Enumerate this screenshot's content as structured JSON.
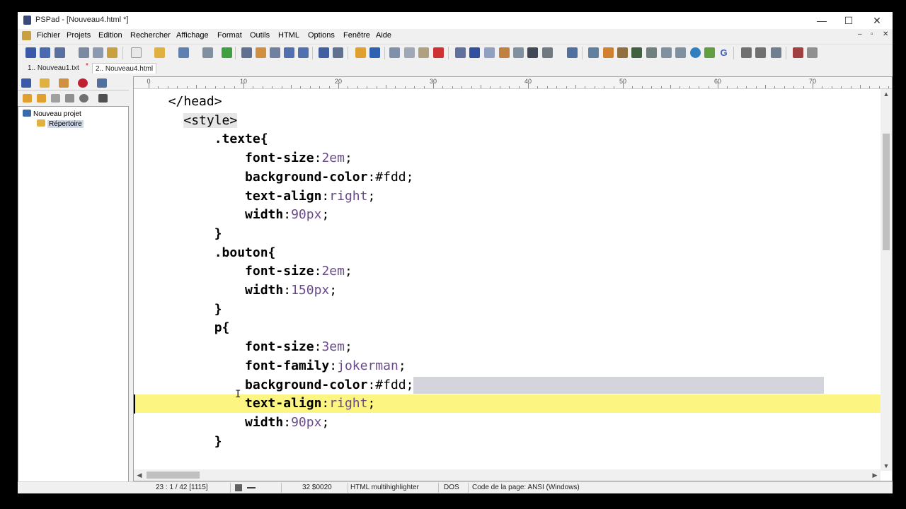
{
  "window": {
    "title": "PSPad - [Nouveau4.html *]",
    "minimize": "—",
    "maximize": "☐",
    "close": "✕"
  },
  "menu": {
    "items": [
      "Fichier",
      "Projets",
      "Edition",
      "Rechercher",
      "Affichage",
      "Format",
      "Outils",
      "HTML",
      "Options",
      "Fenêtre",
      "Aide"
    ],
    "mdi_min": "–",
    "mdi_restore": "▫",
    "mdi_close": "✕"
  },
  "tabs": [
    {
      "label": "1.. Nouveau1.txt",
      "active": false
    },
    {
      "label": "2.. Nouveau4.html",
      "active": true
    }
  ],
  "tab_marker": "*",
  "project_tree": {
    "root": "Nouveau projet",
    "child": "Répertoire"
  },
  "ruler": {
    "labels": [
      "0",
      "10",
      "20",
      "30",
      "40",
      "50",
      "60",
      "70"
    ]
  },
  "code": [
    {
      "indent": "  ",
      "parts": [
        [
          "tag",
          "</head>"
        ]
      ]
    },
    {
      "indent": "    ",
      "parts": [
        [
          "tag",
          "<style>"
        ]
      ]
    },
    {
      "indent": "        ",
      "parts": [
        [
          "k",
          ".texte{"
        ]
      ]
    },
    {
      "indent": "            ",
      "parts": [
        [
          "k",
          "font-size"
        ],
        [
          "p",
          ":"
        ],
        [
          "v",
          "2em"
        ],
        [
          "p",
          ";"
        ]
      ]
    },
    {
      "indent": "            ",
      "parts": [
        [
          "k",
          "background-color"
        ],
        [
          "p",
          ":"
        ],
        [
          "p",
          "#fdd"
        ],
        [
          "p",
          ";"
        ]
      ]
    },
    {
      "indent": "            ",
      "parts": [
        [
          "k",
          "text-align"
        ],
        [
          "p",
          ":"
        ],
        [
          "v",
          "right"
        ],
        [
          "p",
          ";"
        ]
      ]
    },
    {
      "indent": "            ",
      "parts": [
        [
          "k",
          "width"
        ],
        [
          "p",
          ":"
        ],
        [
          "v",
          "90px"
        ],
        [
          "p",
          ";"
        ]
      ]
    },
    {
      "indent": "        ",
      "parts": [
        [
          "k",
          "}"
        ]
      ]
    },
    {
      "indent": "        ",
      "parts": [
        [
          "k",
          ".bouton{"
        ]
      ]
    },
    {
      "indent": "            ",
      "parts": [
        [
          "k",
          "font-size"
        ],
        [
          "p",
          ":"
        ],
        [
          "v",
          "2em"
        ],
        [
          "p",
          ";"
        ]
      ]
    },
    {
      "indent": "            ",
      "parts": [
        [
          "k",
          "width"
        ],
        [
          "p",
          ":"
        ],
        [
          "v",
          "150px"
        ],
        [
          "p",
          ";"
        ]
      ]
    },
    {
      "indent": "        ",
      "parts": [
        [
          "k",
          "}"
        ]
      ]
    },
    {
      "indent": "        ",
      "parts": [
        [
          "k",
          "p{"
        ]
      ]
    },
    {
      "indent": "            ",
      "parts": [
        [
          "k",
          "font-size"
        ],
        [
          "p",
          ":"
        ],
        [
          "v",
          "3em"
        ],
        [
          "p",
          ";"
        ]
      ]
    },
    {
      "indent": "            ",
      "parts": [
        [
          "k",
          "font-family"
        ],
        [
          "p",
          ":"
        ],
        [
          "v",
          "jokerman"
        ],
        [
          "p",
          ";"
        ]
      ]
    },
    {
      "indent": "            ",
      "parts": [
        [
          "k",
          "background-color"
        ],
        [
          "p",
          ":"
        ],
        [
          "p",
          "#fdd"
        ],
        [
          "p",
          ";"
        ]
      ],
      "selected_tail": true
    },
    {
      "indent": "            ",
      "parts": [
        [
          "k",
          "text-align"
        ],
        [
          "p",
          ":"
        ],
        [
          "v",
          "right"
        ],
        [
          "p",
          ";"
        ]
      ],
      "current": true
    },
    {
      "indent": "            ",
      "parts": [
        [
          "k",
          "width"
        ],
        [
          "p",
          ":"
        ],
        [
          "v",
          "90px"
        ],
        [
          "p",
          ";"
        ]
      ]
    },
    {
      "indent": "        ",
      "parts": [
        [
          "k",
          "}"
        ]
      ]
    }
  ],
  "status": {
    "position": "23 : 1 / 42  [1115]",
    "char_code": "32  $0020",
    "highlighter": "HTML multihighlighter",
    "line_endings": "DOS",
    "codepage": "Code de la page: ANSI (Windows)"
  },
  "colors": {
    "current_line": "#fcf582",
    "selection": "#d4d4dc",
    "value_text": "#6a4a8a"
  }
}
